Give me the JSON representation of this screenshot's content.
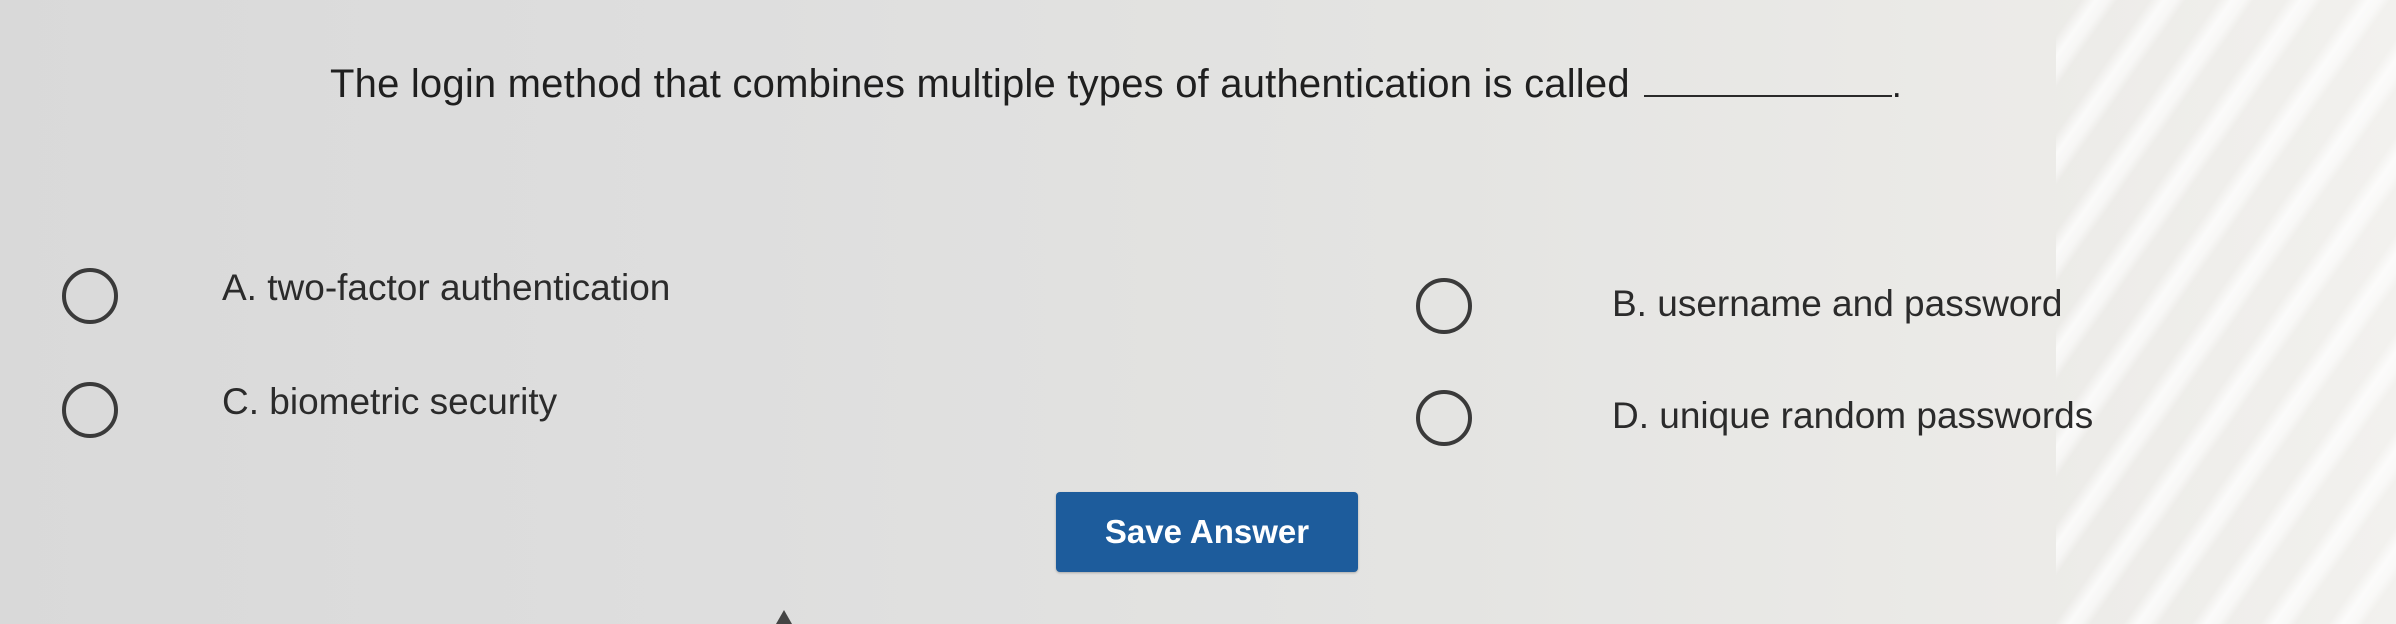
{
  "question": {
    "text": "The login method that combines multiple types of authentication is called",
    "period": "."
  },
  "options": [
    {
      "id": "A",
      "label": "A. two-factor authentication",
      "selected": false
    },
    {
      "id": "B",
      "label": "B. username and password",
      "selected": false
    },
    {
      "id": "C",
      "label": "C. biometric security",
      "selected": false
    },
    {
      "id": "D",
      "label": "D. unique random passwords",
      "selected": false
    }
  ],
  "actions": {
    "save_label": "Save Answer"
  },
  "colors": {
    "button_bg": "#1d5c9c",
    "button_text": "#ffffff",
    "text": "#1f1f1f"
  },
  "icons": {
    "radio": "radio-circle-icon",
    "cursor": "mouse-pointer-icon"
  }
}
